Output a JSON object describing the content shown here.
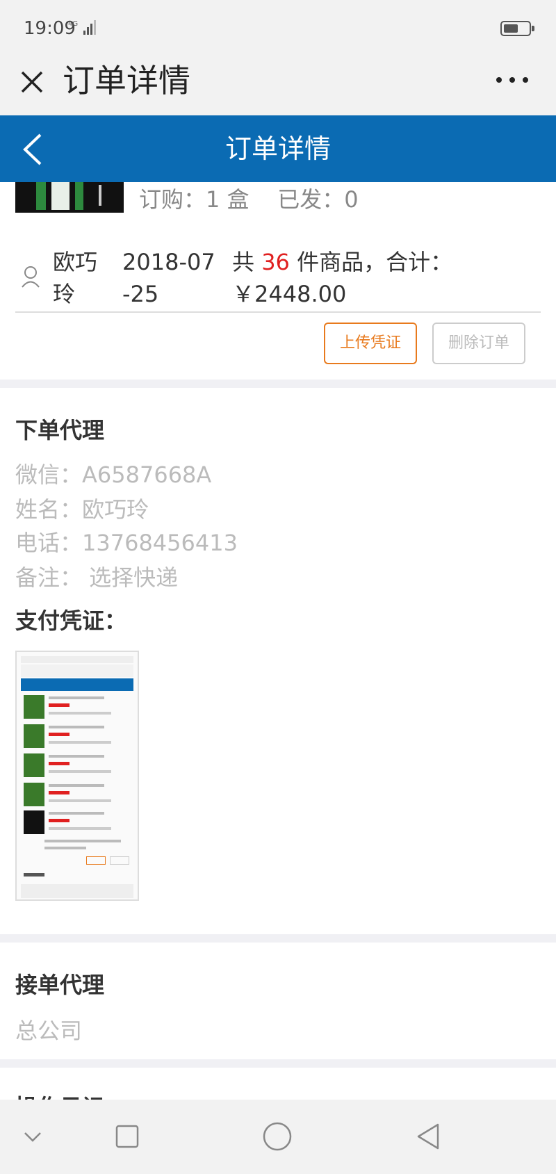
{
  "status_bar": {
    "time": "19:09",
    "network": "4G",
    "battery_level": 0.6
  },
  "wechat_bar": {
    "title": "订单详情",
    "close_icon": "close-icon",
    "more_icon": "more-icon"
  },
  "header": {
    "title": "订单详情",
    "back_icon": "back-arrow-icon",
    "color": "#0b6bb3"
  },
  "order_item": {
    "ordered_label": "订购：",
    "ordered_value": "1 盒",
    "shipped_label": "已发：",
    "shipped_value": "0"
  },
  "summary": {
    "user_name": "欧巧玲",
    "date": "2018-07-25",
    "total_prefix": "共",
    "count": "36",
    "total_mid": "件商品，合计：",
    "total_amount": "￥2448.00",
    "accent_red": "#e02020"
  },
  "actions": {
    "upload_label": "上传凭证",
    "delete_label": "删除订单",
    "upload_color": "#e87a1d"
  },
  "ordering_agent": {
    "title": "下单代理",
    "wechat": "微信：A6587668A",
    "name": "姓名：欧巧玲",
    "phone": "电话：13768456413",
    "note": "备注： 选择快递"
  },
  "payment": {
    "title": "支付凭证："
  },
  "receiving_agent": {
    "title": "接单代理",
    "value": "总公司"
  },
  "next_section": {
    "title": "操作日记"
  },
  "nav": {
    "icons": [
      "chevron-down-icon",
      "square-icon",
      "circle-icon",
      "back-triangle-icon"
    ]
  }
}
